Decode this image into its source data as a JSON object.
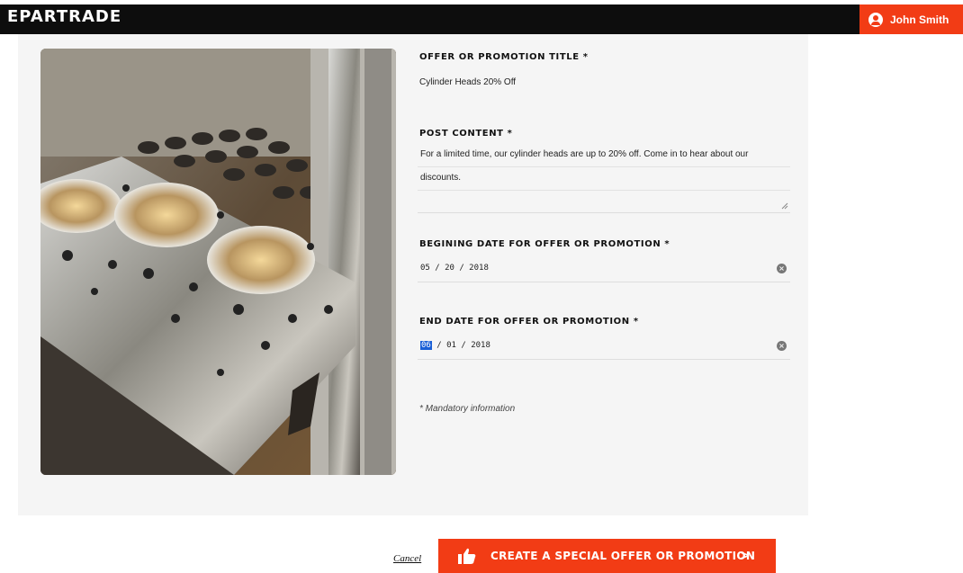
{
  "header": {
    "logo": "EPARTRADE",
    "user_name": "John Smith",
    "icons": {
      "user": "user-circle-icon"
    },
    "colors": {
      "bar": "#0d0d0d",
      "accent": "#f23c15"
    }
  },
  "form": {
    "title_label": "OFFER OR PROMOTION TITLE *",
    "title_value": "Cylinder Heads 20% Off",
    "content_label": "POST CONTENT *",
    "content_line1": "For a limited time, our cylinder heads are up to 20% off. Come in to hear about our",
    "content_line2": "discounts.",
    "begin_label": "BEGINING DATE FOR OFFER OR PROMOTION *",
    "begin_date": "05 / 20 / 2018",
    "end_label": "END DATE FOR OFFER OR PROMOTION *",
    "end_date_month": "06",
    "end_date_rest": "/ 01 / 2018",
    "mandatory_note": "* Mandatory information"
  },
  "footer": {
    "cancel_label": "Cancel",
    "cta_label": "CREATE A SPECIAL OFFER OR PROMOTION",
    "cta_chevron": ">",
    "icons": {
      "cta": "thumbs-up-icon",
      "chevron": "chevron-right-icon"
    }
  }
}
